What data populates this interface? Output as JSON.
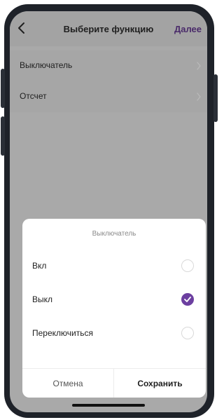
{
  "header": {
    "title": "Выберите функцию",
    "next_label": "Далее",
    "back_icon": "chevron-left-icon"
  },
  "list": {
    "items": [
      {
        "label": "Выключатель",
        "icon": "chevron-right-icon"
      },
      {
        "label": "Отсчет",
        "icon": "chevron-right-icon"
      }
    ]
  },
  "sheet": {
    "title": "Выключатель",
    "options": [
      {
        "label": "Вкл",
        "selected": false
      },
      {
        "label": "Выкл",
        "selected": true
      },
      {
        "label": "Переключиться",
        "selected": false
      }
    ],
    "cancel_label": "Отмена",
    "save_label": "Сохранить"
  },
  "colors": {
    "accent": "#6c3fa0",
    "next_text": "#4a2b6a",
    "overlay": "#a9a9a9"
  }
}
